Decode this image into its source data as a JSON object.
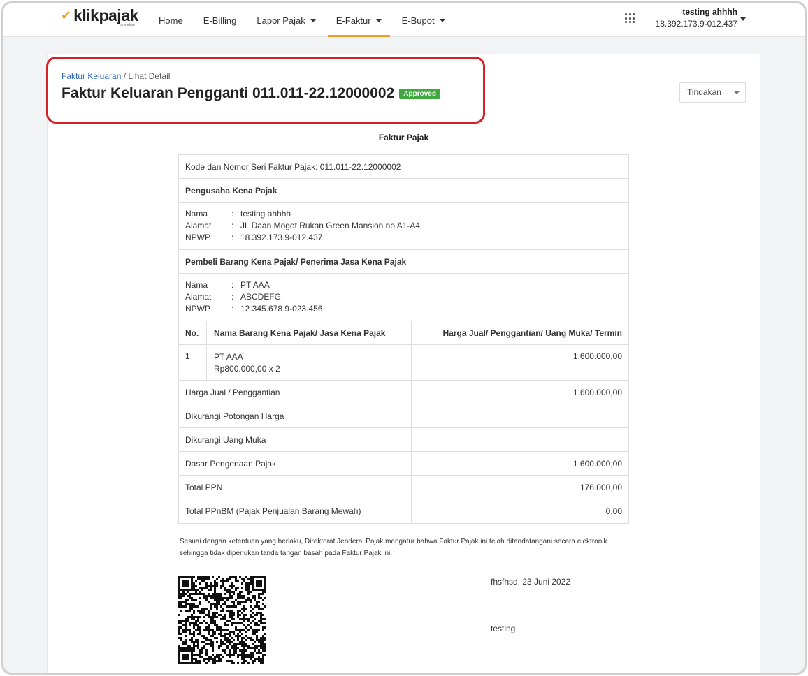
{
  "navbar": {
    "logo_text": "klikpajak",
    "logo_sub": "by mekari",
    "items": [
      {
        "label": "Home",
        "dropdown": false,
        "active": false
      },
      {
        "label": "E-Billing",
        "dropdown": false,
        "active": false
      },
      {
        "label": "Lapor Pajak",
        "dropdown": true,
        "active": false
      },
      {
        "label": "E-Faktur",
        "dropdown": true,
        "active": true
      },
      {
        "label": "E-Bupot",
        "dropdown": true,
        "active": false
      }
    ],
    "user_name": "testing ahhhh",
    "user_npwp": "18.392.173.9-012.437"
  },
  "breadcrumb": {
    "parent": "Faktur Keluaran",
    "separator": " / ",
    "current": "Lihat Detail"
  },
  "page_title": "Faktur Keluaran Pengganti 011.011-22.12000002",
  "status_badge": "Approved",
  "action_button": "Tindakan",
  "document": {
    "title": "Faktur Pajak",
    "serial": "Kode dan Nomor Seri Faktur Pajak: 011.011-22.12000002",
    "seller_heading": "Pengusaha Kena Pajak",
    "seller": {
      "name_label": "Nama",
      "name": "testing ahhhh",
      "address_label": "Alamat",
      "address": "JL Daan Mogot Rukan Green Mansion no A1-A4",
      "npwp_label": "NPWP",
      "npwp": "18.392.173.9-012.437"
    },
    "buyer_heading": "Pembeli Barang Kena Pajak/ Penerima Jasa Kena Pajak",
    "buyer": {
      "name_label": "Nama",
      "name": "PT AAA",
      "address_label": "Alamat",
      "address": "ABCDEFG",
      "npwp_label": "NPWP",
      "npwp": "12.345.678.9-023.456"
    },
    "items_header": {
      "no": "No.",
      "name": "Nama Barang Kena Pajak/ Jasa Kena Pajak",
      "price": "Harga Jual/ Penggantian/ Uang Muka/ Termin"
    },
    "items": [
      {
        "no": "1",
        "name": "PT AAA",
        "detail": "Rp800.000,00 x 2",
        "price": "1.600.000,00"
      }
    ],
    "summary": [
      {
        "label": "Harga Jual / Penggantian",
        "value": "1.600.000,00"
      },
      {
        "label": "Dikurangi Potongan Harga",
        "value": ""
      },
      {
        "label": "Dikurangi Uang Muka",
        "value": ""
      },
      {
        "label": "Dasar Pengenaan Pajak",
        "value": "1.600.000,00"
      },
      {
        "label": "Total PPN",
        "value": "176.000,00"
      },
      {
        "label": "Total PPnBM (Pajak Penjualan Barang Mewah)",
        "value": "0,00"
      }
    ],
    "note": "Sesuai dengan ketentuan yang berlaku, Direktorat Jenderal Pajak mengatur bahwa Faktur Pajak ini telah ditandatangani secara elektronik sehingga tidak diperlukan tanda tangan basah pada Faktur Pajak ini.",
    "sign_place_date": "fhsfhsd, 23 Juni 2022",
    "signer": "testing"
  },
  "colors": {
    "accent": "#f39a1e",
    "link": "#2f68b4",
    "badge_green": "#3fa93f",
    "highlight_red": "#d81f26"
  }
}
